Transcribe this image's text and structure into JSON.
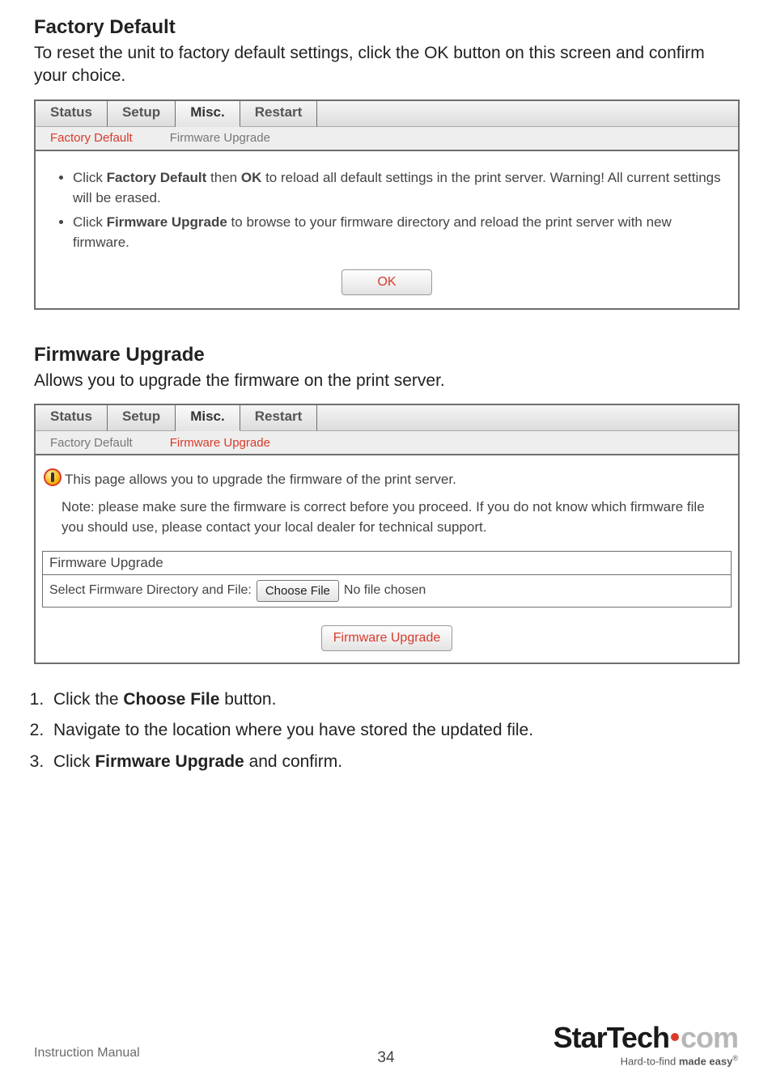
{
  "section1": {
    "heading": "Factory Default",
    "intro": "To reset the unit to factory default settings, click the OK button on this screen and confirm your choice."
  },
  "shot1": {
    "tabs": [
      "Status",
      "Setup",
      "Misc.",
      "Restart"
    ],
    "activeTab": 2,
    "subtabs": [
      "Factory Default",
      "Firmware Upgrade"
    ],
    "activeSubtab": 0,
    "bullet1_a": "Click ",
    "bullet1_b": "Factory Default",
    "bullet1_c": " then ",
    "bullet1_d": "OK",
    "bullet1_e": " to reload all default settings in the print server. Warning! All current settings will be erased.",
    "bullet2_a": "Click ",
    "bullet2_b": "Firmware Upgrade",
    "bullet2_c": " to browse to your firmware directory and reload the print server with new firmware.",
    "ok": "OK"
  },
  "section2": {
    "heading": "Firmware Upgrade",
    "intro": "Allows you to upgrade the firmware on the print server."
  },
  "shot2": {
    "tabs": [
      "Status",
      "Setup",
      "Misc.",
      "Restart"
    ],
    "activeTab": 2,
    "subtabs": [
      "Factory Default",
      "Firmware Upgrade"
    ],
    "activeSubtab": 1,
    "introline": "This page allows you to upgrade the firmware of the print server.",
    "note_label": "Note:",
    "note_text": " please make sure the firmware is correct before you proceed. If you do not know which firmware file you should use, please contact your local dealer for technical support.",
    "fwbox_title": "Firmware Upgrade",
    "select_label": "Select Firmware Directory and File:",
    "choose_file": "Choose File",
    "no_file": "No file chosen",
    "fw_upgrade_btn": "Firmware Upgrade"
  },
  "steps": {
    "s1a": "Click the ",
    "s1b": "Choose File",
    "s1c": " button.",
    "s2": "Navigate to the location where you have stored the updated file.",
    "s3a": "Click ",
    "s3b": "Firmware Upgrade",
    "s3c": " and confirm."
  },
  "footer": {
    "manual": "Instruction Manual",
    "page": "34",
    "brand_left": "StarTech",
    "brand_right": "com",
    "tag_a": "Hard-to-find ",
    "tag_b": "made easy"
  }
}
